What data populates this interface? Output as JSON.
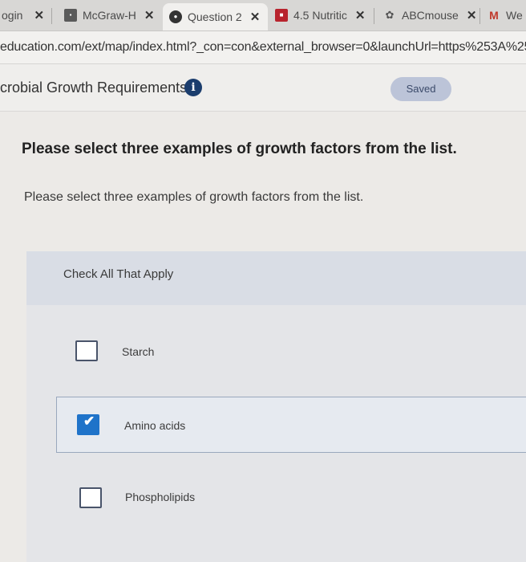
{
  "browser": {
    "tabs": [
      {
        "label": "ogin",
        "icon": "",
        "close": "✕"
      },
      {
        "label": "McGraw-H",
        "icon": "mcgraw-favicon-icon",
        "close": "✕"
      },
      {
        "label": "Question 2",
        "icon": "connect-favicon-icon",
        "close": "✕"
      },
      {
        "label": "4.5 Nutritic",
        "icon": "mcgraw-favicon-icon",
        "close": "✕"
      },
      {
        "label": "ABCmouse",
        "icon": "abcmouse-favicon-icon",
        "close": "✕"
      },
      {
        "label": "We",
        "icon": "m-favicon-icon",
        "close": ""
      }
    ],
    "url": "education.com/ext/map/index.html?_con=con&external_browser=0&launchUrl=https%253A%25"
  },
  "header": {
    "title": "crobial Growth Requirements",
    "info_glyph": "i",
    "saved_label": "Saved"
  },
  "question": {
    "heading": "Please select three examples of growth factors from the list.",
    "prompt": "Please select three examples of growth factors from the list.",
    "instruction": "Check All That Apply",
    "choices": [
      {
        "label": "Starch",
        "checked": false
      },
      {
        "label": "Amino acids",
        "checked": true
      },
      {
        "label": "Phospholipids",
        "checked": false
      }
    ]
  },
  "colors": {
    "accent": "#1f73c9",
    "saved_badge": "#bcc4d8",
    "info_icon": "#1b3d6d"
  }
}
